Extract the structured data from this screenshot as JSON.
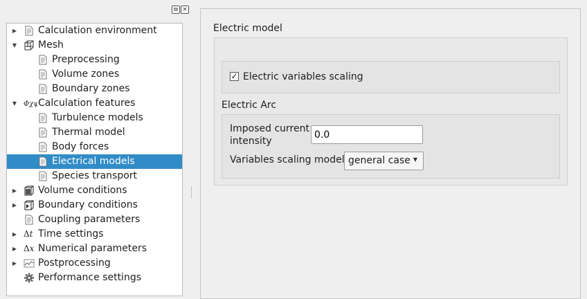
{
  "tree": {
    "items": [
      {
        "label": "Calculation environment",
        "icon": "page-icon",
        "expander": "collapsed",
        "indent": 0
      },
      {
        "label": "Mesh",
        "icon": "mesh-cube-icon",
        "expander": "expanded",
        "indent": 0
      },
      {
        "label": "Preprocessing",
        "icon": "page-icon",
        "expander": "none",
        "indent": 1
      },
      {
        "label": "Volume zones",
        "icon": "page-icon",
        "expander": "none",
        "indent": 1
      },
      {
        "label": "Boundary zones",
        "icon": "page-icon",
        "expander": "none",
        "indent": 1
      },
      {
        "label": "Calculation features",
        "icon": "physics-formula-icon",
        "expander": "expanded",
        "indent": 0
      },
      {
        "label": "Turbulence models",
        "icon": "page-icon",
        "expander": "none",
        "indent": 1
      },
      {
        "label": "Thermal model",
        "icon": "page-icon",
        "expander": "none",
        "indent": 1
      },
      {
        "label": "Body forces",
        "icon": "page-icon",
        "expander": "none",
        "indent": 1
      },
      {
        "label": "Electrical models",
        "icon": "page-icon",
        "expander": "none",
        "indent": 1,
        "selected": true
      },
      {
        "label": "Species transport",
        "icon": "page-icon",
        "expander": "none",
        "indent": 1
      },
      {
        "label": "Volume conditions",
        "icon": "volume-cube-icon",
        "expander": "collapsed",
        "indent": 0
      },
      {
        "label": "Boundary conditions",
        "icon": "boundary-cube-icon",
        "expander": "collapsed",
        "indent": 0
      },
      {
        "label": "Coupling parameters",
        "icon": "page-icon",
        "expander": "none",
        "indent": 0
      },
      {
        "label": "Time settings",
        "icon": "delta-t-icon",
        "expander": "collapsed",
        "indent": 0
      },
      {
        "label": "Numerical parameters",
        "icon": "delta-x-icon",
        "expander": "collapsed",
        "indent": 0
      },
      {
        "label": "Postprocessing",
        "icon": "chart-icon",
        "expander": "collapsed",
        "indent": 0
      },
      {
        "label": "Performance settings",
        "icon": "gear-icon",
        "expander": "none",
        "indent": 0
      }
    ]
  },
  "electric_model": {
    "title": "Electric model",
    "scaling_checkbox": {
      "label": "Electric variables scaling",
      "checked": true,
      "mark": "✓"
    },
    "arc": {
      "title": "Electric Arc",
      "current_label_line1": "Imposed current",
      "current_label_line2": "intensity",
      "current_value": "0.0",
      "scaling_model_label": "Variables scaling model",
      "scaling_model_value": "general case"
    }
  },
  "dock": {
    "float_symbol": "⧉",
    "close_symbol": "✕"
  },
  "colors": {
    "selection": "#308cc6",
    "selection_text": "#ffffff"
  }
}
